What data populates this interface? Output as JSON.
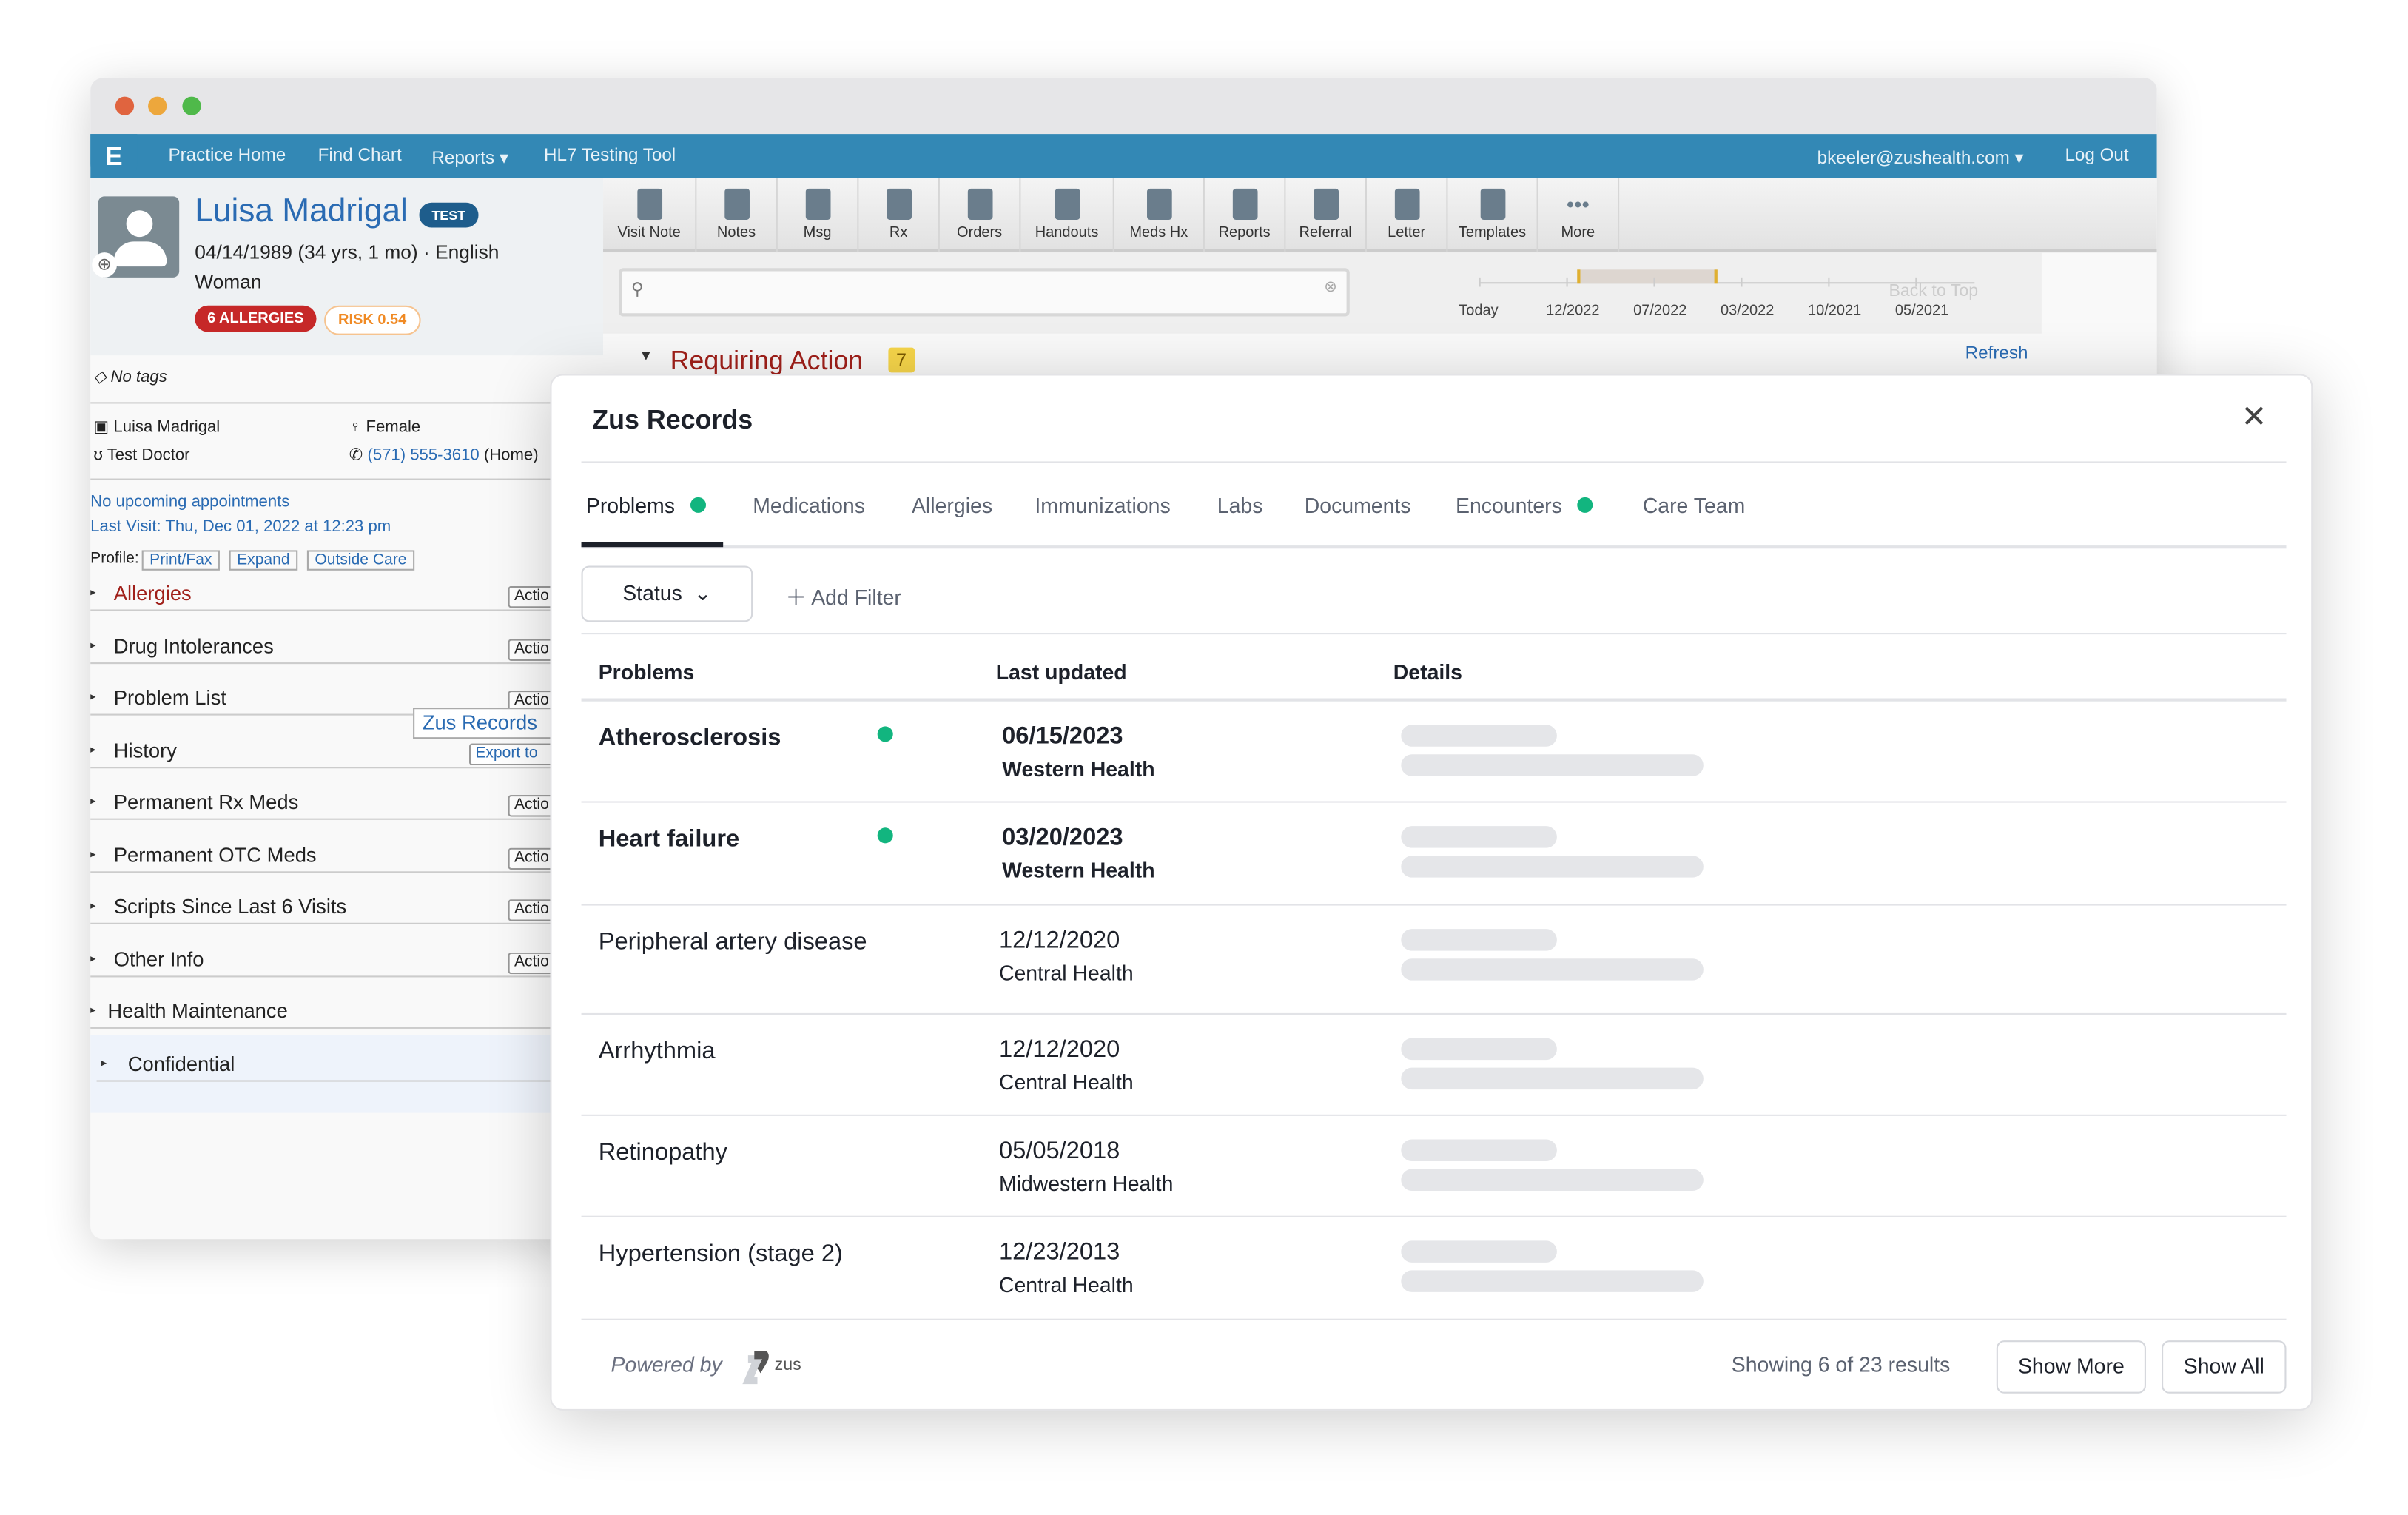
{
  "nav": {
    "items": [
      "Practice Home",
      "Find Chart",
      "Reports",
      "HL7 Testing Tool"
    ],
    "user": "bkeeler@zushealth.com",
    "logout": "Log Out"
  },
  "patient": {
    "name": "Luisa Madrigal",
    "test_badge": "TEST",
    "dob_line": "04/14/1989 (34 yrs, 1 mo) · English",
    "gender_identity": "Woman",
    "allergies_badge": "6 ALLERGIES",
    "risk_badge": "RISK 0.54",
    "tags": "No tags",
    "legal_name": "Luisa Madrigal",
    "sex": "Female",
    "doctor": "Test Doctor",
    "phone": "(571) 555-3610",
    "phone_type": "(Home)",
    "appointments": "No upcoming appointments",
    "last_visit": "Last Visit: Thu, Dec 01, 2022 at 12:23 pm",
    "profile_label": "Profile:",
    "profile_buttons": [
      "Print/Fax",
      "Expand",
      "Outside Care"
    ]
  },
  "sections": [
    {
      "label": "Allergies",
      "action": "Actio",
      "highlight": true
    },
    {
      "label": "Drug Intolerances",
      "action": "Actio"
    },
    {
      "label": "Problem List",
      "action": "Actio"
    },
    {
      "label": "History",
      "action": "Export to"
    },
    {
      "label": "Permanent Rx Meds",
      "action": "Actio"
    },
    {
      "label": "Permanent OTC Meds",
      "action": "Actio"
    },
    {
      "label": "Scripts Since Last 6 Visits",
      "action": "Actio"
    },
    {
      "label": "Other Info",
      "action": "Actio"
    },
    {
      "label": "Health Maintenance"
    },
    {
      "label": "Confidential"
    }
  ],
  "zus_records_button": "Zus Records",
  "toolbar": [
    "Visit Note",
    "Notes",
    "Msg",
    "Rx",
    "Orders",
    "Handouts",
    "Meds Hx",
    "Reports",
    "Referral",
    "Letter",
    "Templates",
    "More"
  ],
  "timeline": {
    "labels": [
      "Today",
      "12/2022",
      "07/2022",
      "03/2022",
      "10/2021",
      "05/2021"
    ],
    "back_to_top": "Back to Top"
  },
  "requiring_action": {
    "label": "Requiring Action",
    "count": "7",
    "refresh": "Refresh"
  },
  "modal": {
    "title": "Zus Records",
    "tabs": [
      {
        "label": "Problems",
        "dot": true,
        "active": true
      },
      {
        "label": "Medications"
      },
      {
        "label": "Allergies"
      },
      {
        "label": "Immunizations"
      },
      {
        "label": "Labs"
      },
      {
        "label": "Documents"
      },
      {
        "label": "Encounters",
        "dot": true
      },
      {
        "label": "Care Team"
      }
    ],
    "status_filter": "Status",
    "add_filter": "Add Filter",
    "columns": [
      "Problems",
      "Last updated",
      "Details"
    ],
    "rows": [
      {
        "problem": "Atherosclerosis",
        "new": true,
        "date": "06/15/2023",
        "source": "Western Health"
      },
      {
        "problem": "Heart failure",
        "new": true,
        "date": "03/20/2023",
        "source": "Western Health"
      },
      {
        "problem": "Peripheral artery disease",
        "new": false,
        "date": "12/12/2020",
        "source": "Central Health"
      },
      {
        "problem": "Arrhythmia",
        "new": false,
        "date": "12/12/2020",
        "source": "Central Health"
      },
      {
        "problem": "Retinopathy",
        "new": false,
        "date": "05/05/2018",
        "source": "Midwestern Health"
      },
      {
        "problem": "Hypertension (stage 2)",
        "new": false,
        "date": "12/23/2013",
        "source": "Central Health"
      }
    ],
    "powered_by": "Powered by",
    "brand": "zus",
    "showing": "Showing 6 of 23 results",
    "show_more": "Show More",
    "show_all": "Show All"
  },
  "colors": {
    "nav": "#3388b5",
    "accent_green": "#12b57f",
    "allergy_red": "#c62828",
    "risk_orange": "#f08a24",
    "link_blue": "#2a6bb3"
  }
}
